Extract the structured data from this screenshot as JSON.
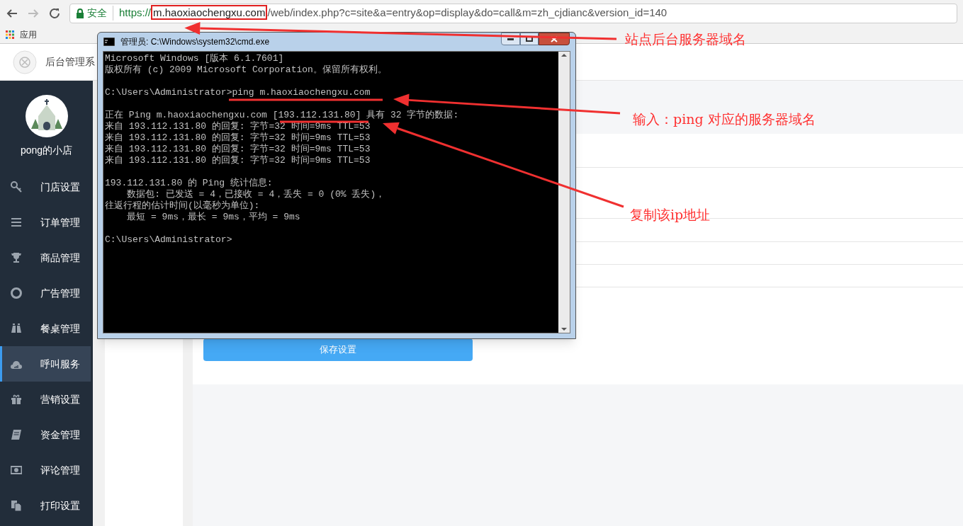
{
  "browser": {
    "secure_label": "安全",
    "url_parts": [
      {
        "text": "https://",
        "highlighted": false
      },
      {
        "text": "m.haoxiaochengxu.com",
        "highlighted": true
      },
      {
        "text": "/web/index.php?c=site&a=entry&op=display&do=call&m=zh_cjdianc&version_id=140",
        "highlighted": false
      }
    ],
    "bookmarks": [
      "应用"
    ]
  },
  "header": {
    "title": "后台管理系"
  },
  "sidebar": {
    "shop_name": "pong的小店",
    "items": [
      {
        "label": "门店设置",
        "selected": false
      },
      {
        "label": "订单管理",
        "selected": false
      },
      {
        "label": "商品管理",
        "selected": false
      },
      {
        "label": "广告管理",
        "selected": false
      },
      {
        "label": "餐桌管理",
        "selected": false
      },
      {
        "label": "呼叫服务",
        "selected": true
      },
      {
        "label": "营销设置",
        "selected": false
      },
      {
        "label": "资金管理",
        "selected": false
      },
      {
        "label": "评论管理",
        "selected": false
      },
      {
        "label": "打印设置",
        "selected": false
      }
    ]
  },
  "content": {
    "save_button": "保存设置"
  },
  "cmd_window": {
    "title": "管理员: C:\\Windows\\system32\\cmd.exe",
    "blocks": [
      [
        "Microsoft Windows [版本 6.1.7601]",
        "版权所有 (c) 2009 Microsoft Corporation。保留所有权利。"
      ],
      [
        "C:\\Users\\Administrator>ping m.haoxiaochengxu.com"
      ],
      [
        "正在 Ping m.haoxiaochengxu.com [193.112.131.80] 具有 32 字节的数据:",
        "来自 193.112.131.80 的回复: 字节=32 时间=9ms TTL=53",
        "来自 193.112.131.80 的回复: 字节=32 时间=9ms TTL=53",
        "来自 193.112.131.80 的回复: 字节=32 时间=9ms TTL=53",
        "来自 193.112.131.80 的回复: 字节=32 时间=9ms TTL=53"
      ],
      [
        "193.112.131.80 的 Ping 统计信息:",
        "    数据包: 已发送 = 4，已接收 = 4，丢失 = 0 (0% 丢失)，",
        "往返行程的估计时间(以毫秒为单位):",
        "    最短 = 9ms，最长 = 9ms，平均 = 9ms"
      ],
      [
        "C:\\Users\\Administrator>"
      ]
    ]
  },
  "annotations": [
    "站点后台服务器域名",
    "输入：ping 对应的服务器域名",
    "复制该ip地址"
  ]
}
